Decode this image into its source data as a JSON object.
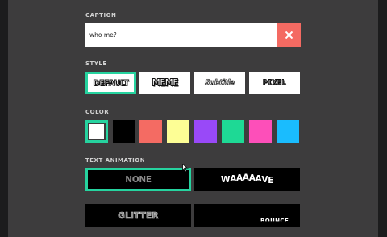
{
  "caption": {
    "label": "CAPTION",
    "value": "who me?"
  },
  "style": {
    "label": "STYLE",
    "options": [
      {
        "label": "DEFAULT",
        "selected": true
      },
      {
        "label": "MEME",
        "selected": false
      },
      {
        "label": "Subtitle",
        "selected": false
      },
      {
        "label": "PIXEL",
        "selected": false
      }
    ]
  },
  "color": {
    "label": "COLOR",
    "swatches": [
      "#ffffff",
      "#000000",
      "#f46b63",
      "#fdfe95",
      "#9949f8",
      "#1ed995",
      "#fd4fb9",
      "#1abcfe"
    ],
    "selected_index": 0
  },
  "animation": {
    "label": "TEXT ANIMATION",
    "options": [
      {
        "label": "NONE",
        "selected": true
      },
      {
        "label": "WAAAAAVE",
        "selected": false
      },
      {
        "label": "GLITTER",
        "selected": false
      },
      {
        "label": "",
        "selected": false
      }
    ]
  },
  "colors": {
    "accent": "#26d39f",
    "clear": "#f46a62",
    "panel": "#3d3c3d"
  },
  "icons": {
    "clear": "close-icon",
    "pointer": "mouse-pointer-icon"
  }
}
